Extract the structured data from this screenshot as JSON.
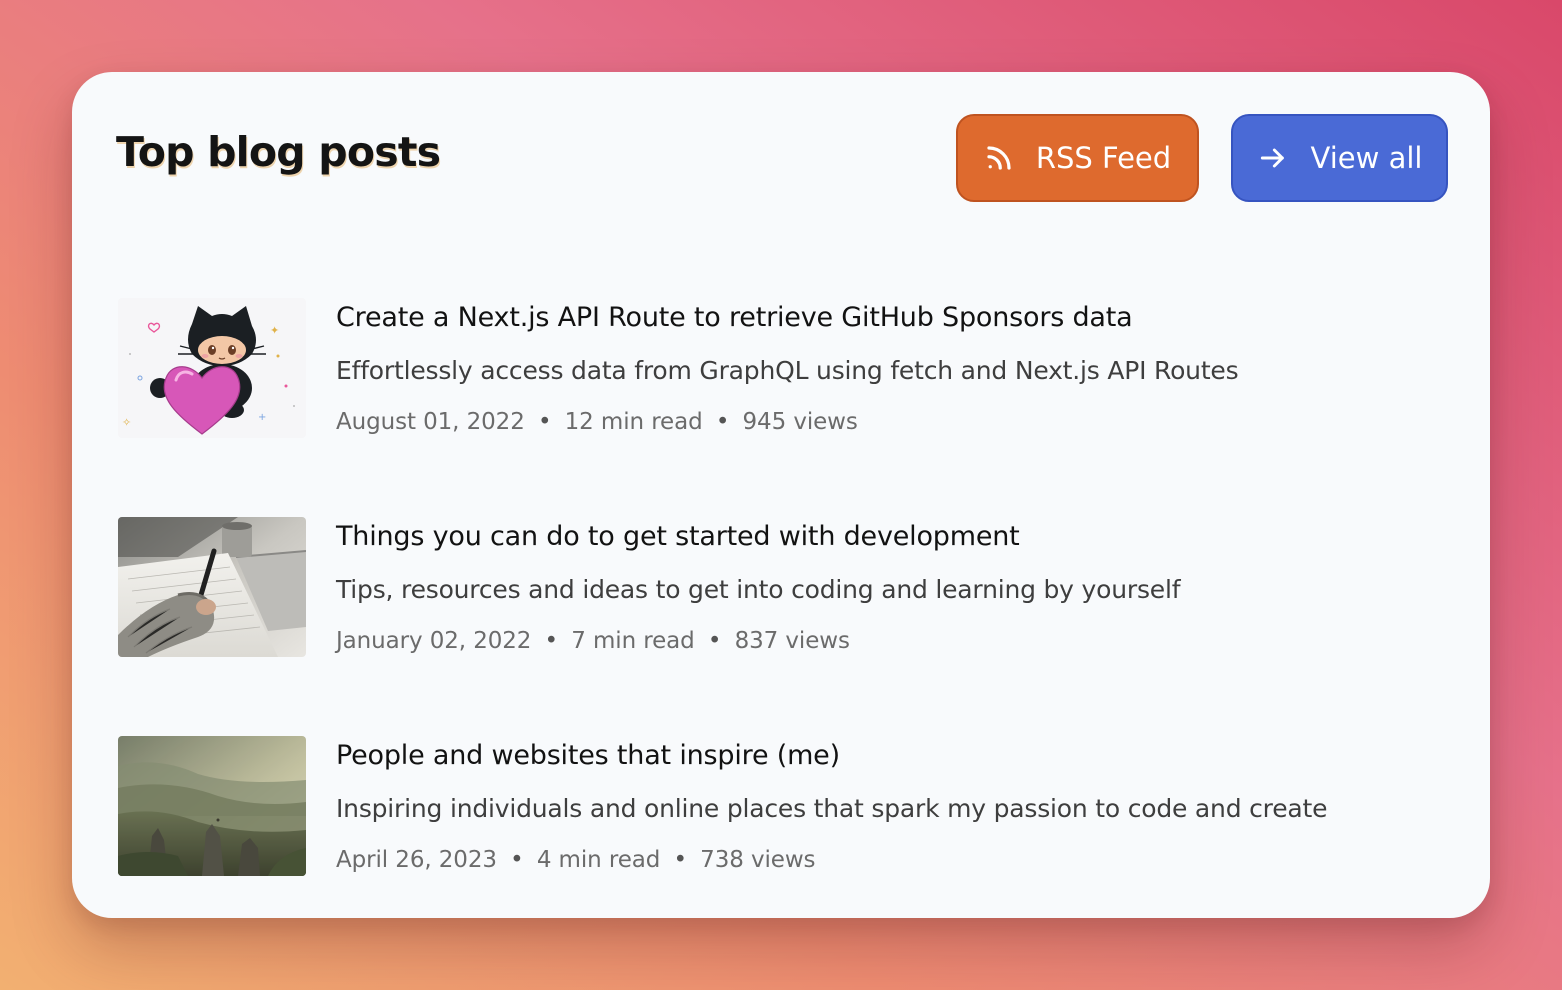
{
  "header": {
    "title": "Top blog posts",
    "rss_label": "RSS Feed",
    "view_all_label": "View all"
  },
  "colors": {
    "rss_button": "#de6a2e",
    "view_all_button": "#4a6ad6",
    "card_background": "#f8fafc"
  },
  "icons": {
    "rss": "rss-icon",
    "view_all": "arrow-right-icon"
  },
  "posts": [
    {
      "title": "Create a Next.js API Route to retrieve GitHub Sponsors data",
      "description": "Effortlessly access data from GraphQL using fetch and Next.js API Routes",
      "date": "August 01, 2022",
      "read_time": "12 min read",
      "views": "945 views",
      "separator": "•",
      "thumbnail": "octocat-with-heart-illustration"
    },
    {
      "title": "Things you can do to get started with development",
      "description": "Tips, resources and ideas to get into coding and learning by yourself",
      "date": "January 02, 2022",
      "read_time": "7 min read",
      "views": "837 views",
      "separator": "•",
      "thumbnail": "hand-writing-on-paper-photo"
    },
    {
      "title": "People and websites that inspire (me)",
      "description": "Inspiring individuals and online places that spark my passion to code and create",
      "date": "April 26, 2023",
      "read_time": "4 min read",
      "views": "738 views",
      "separator": "•",
      "thumbnail": "misty-mountain-landscape-photo"
    }
  ]
}
